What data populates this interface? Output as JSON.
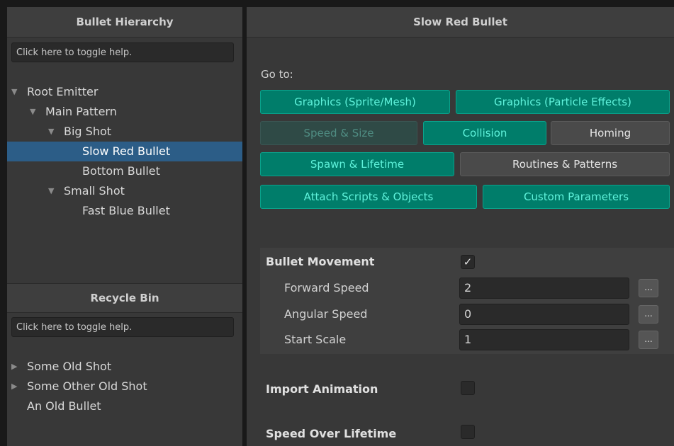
{
  "left_panel": {
    "title": "Bullet Hierarchy",
    "help": "Click here to toggle help.",
    "tree": [
      {
        "label": "Root Emitter",
        "expanded": true
      },
      {
        "label": "Main Pattern",
        "expanded": true
      },
      {
        "label": "Big Shot",
        "expanded": true
      },
      {
        "label": "Slow Red Bullet",
        "selected": true
      },
      {
        "label": "Bottom Bullet"
      },
      {
        "label": "Small Shot",
        "expanded": true
      },
      {
        "label": "Fast Blue Bullet"
      }
    ],
    "tri_expanded": "▼",
    "tri_collapsed": "▶"
  },
  "recycle_bin": {
    "title": "Recycle Bin",
    "help": "Click here to toggle help.",
    "items": [
      {
        "label": "Some Old Shot",
        "collapsed": true
      },
      {
        "label": "Some Other Old Shot",
        "collapsed": true
      },
      {
        "label": "An Old Bullet"
      }
    ]
  },
  "right_panel": {
    "title": "Slow Red Bullet",
    "goto_label": "Go to:",
    "buttons": {
      "graphics_sprite": "Graphics (Sprite/Mesh)",
      "graphics_particle": "Graphics (Particle Effects)",
      "speed_size": "Speed & Size",
      "collision": "Collision",
      "homing": "Homing",
      "spawn_lifetime": "Spawn & Lifetime",
      "routines_patterns": "Routines & Patterns",
      "attach_scripts": "Attach Scripts & Objects",
      "custom_parameters": "Custom Parameters"
    },
    "bullet_movement": {
      "label": "Bullet Movement",
      "checked": "✓",
      "fields": [
        {
          "label": "Forward Speed",
          "value": "2"
        },
        {
          "label": "Angular Speed",
          "value": "0"
        },
        {
          "label": "Start Scale",
          "value": "1"
        }
      ],
      "dots": "..."
    },
    "import_animation": "Import Animation",
    "speed_over_lifetime": "Speed Over Lifetime"
  },
  "colors": {
    "teal": "#007d6a",
    "teal_text": "#5ff2db",
    "selection": "#2c5d87"
  }
}
